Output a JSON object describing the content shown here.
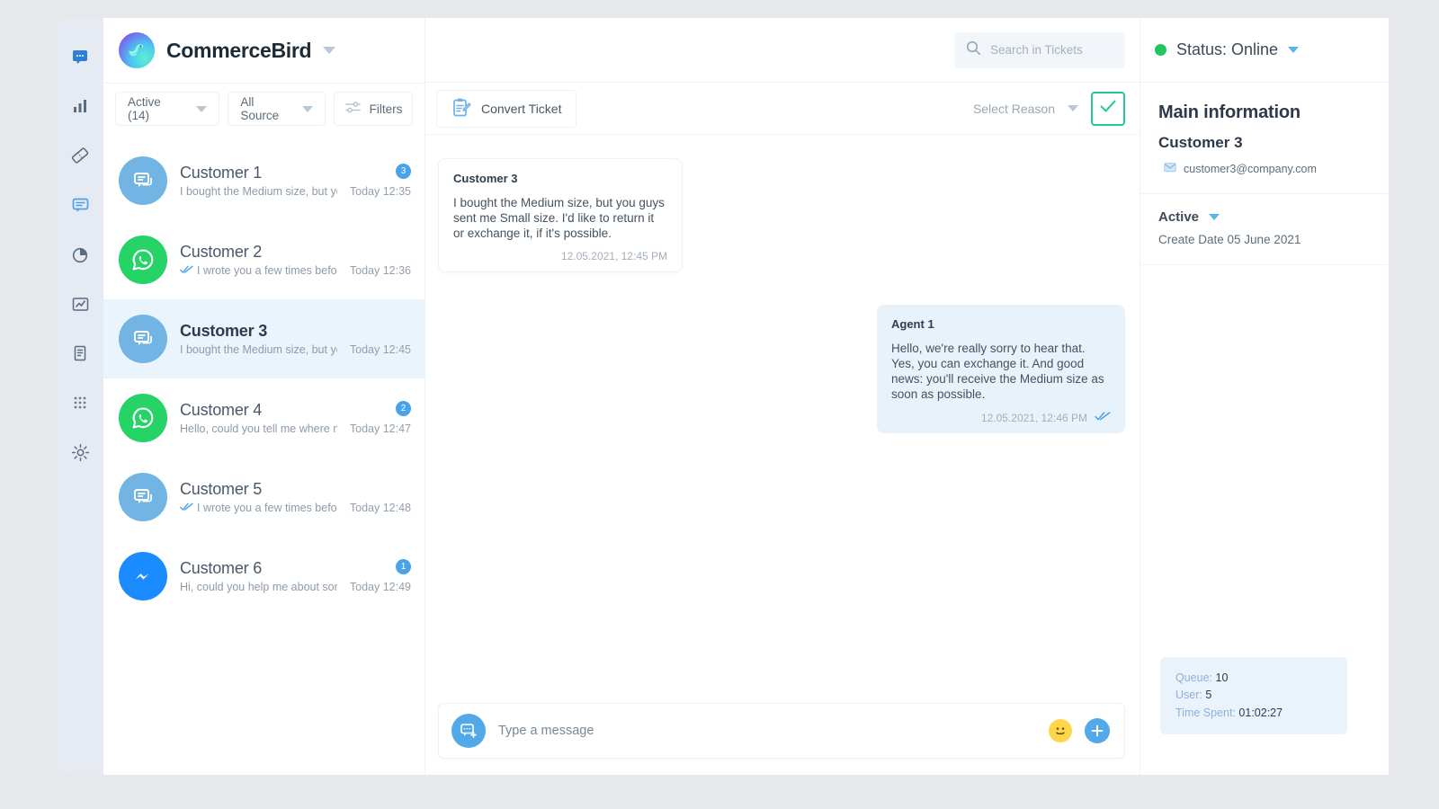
{
  "brand": {
    "name": "CommerceBird",
    "logo_icon": "bird-logo-icon",
    "caret_icon": "chevron-down-icon"
  },
  "rail": {
    "items": [
      {
        "name": "sidebar-item-inbox",
        "icon": "chat-bubble-filled-icon",
        "active": true
      },
      {
        "name": "sidebar-item-statistics",
        "icon": "bar-chart-icon",
        "active": false
      },
      {
        "name": "sidebar-item-tickets",
        "icon": "ticket-icon",
        "active": false
      },
      {
        "name": "sidebar-item-messages",
        "icon": "chat-outline-icon",
        "active": false
      },
      {
        "name": "sidebar-item-reports",
        "icon": "pie-chart-icon",
        "active": false
      },
      {
        "name": "sidebar-item-analytics",
        "icon": "line-chart-icon",
        "active": false
      },
      {
        "name": "sidebar-item-documents",
        "icon": "document-icon",
        "active": false
      },
      {
        "name": "sidebar-item-apps",
        "icon": "grid-dots-icon",
        "active": false
      },
      {
        "name": "sidebar-item-settings",
        "icon": "gear-icon",
        "active": false
      }
    ]
  },
  "filters": {
    "status": "Active (14)",
    "source": "All Source",
    "filters_label": "Filters",
    "filters_icon": "sliders-icon"
  },
  "conversations": [
    {
      "name": "Customer 1",
      "snippet": "I bought the Medium size, but you guys...",
      "time": "Today 12:35",
      "badge": "3",
      "channel": "chat",
      "read_receipt": false,
      "selected": false
    },
    {
      "name": "Customer 2",
      "snippet": "I wrote you a few times before for...",
      "time": "Today 12:36",
      "badge": "",
      "channel": "whatsapp",
      "read_receipt": true,
      "selected": false
    },
    {
      "name": "Customer 3",
      "snippet": "I bought the Medium size, but you...",
      "time": "Today 12:45",
      "badge": "",
      "channel": "chat",
      "read_receipt": false,
      "selected": true
    },
    {
      "name": "Customer 4",
      "snippet": "Hello, could you tell me where my...",
      "time": "Today 12:47",
      "badge": "2",
      "channel": "whatsapp",
      "read_receipt": false,
      "selected": false
    },
    {
      "name": "Customer 5",
      "snippet": "I wrote you a few times before for...",
      "time": "Today 12:48",
      "badge": "",
      "channel": "chat",
      "read_receipt": true,
      "selected": false
    },
    {
      "name": "Customer 6",
      "snippet": "Hi, could you help me about something?",
      "time": "Today 12:49",
      "badge": "1",
      "channel": "messenger",
      "read_receipt": false,
      "selected": false
    }
  ],
  "search": {
    "placeholder": "Search in Tickets",
    "value": "",
    "icon": "search-icon"
  },
  "toolbar": {
    "convert_label": "Convert Ticket",
    "convert_icon": "clipboard-edit-icon",
    "reason_label": "Select Reason",
    "reason_caret_icon": "chevron-down-icon",
    "confirm_icon": "check-icon"
  },
  "messages": [
    {
      "author": "Customer 3",
      "text": "I bought the Medium size, but you guys sent me Small size. I'd like to return it or exchange it, if it's possible.",
      "time": "12.05.2021, 12:45 PM",
      "direction": "in",
      "read_receipt": false
    },
    {
      "author": "Agent 1",
      "text": "Hello, we're really sorry to hear that. Yes, you can exchange it. And good news: you'll receive the Medium size as soon as possible.",
      "time": "12.05.2021, 12:46 PM",
      "direction": "out",
      "read_receipt": true
    }
  ],
  "composer": {
    "placeholder": "Type a message",
    "value": "",
    "add_icon": "add-message-icon",
    "emoji_icon": "smiley-icon",
    "plus_icon": "plus-icon"
  },
  "info": {
    "status_label": "Status: Online",
    "status_dot_color": "#22c55e",
    "status_caret_icon": "chevron-down-icon",
    "heading": "Main information",
    "customer_name": "Customer 3",
    "email": "customer3@company.com",
    "email_icon": "envelope-icon",
    "state_label": "Active",
    "state_caret_icon": "chevron-down-icon",
    "create_date": "Create Date 05 June 2021"
  },
  "stats": {
    "queue_label": "Queue:",
    "queue_value": "10",
    "user_label": "User:",
    "user_value": "5",
    "time_label": "Time Spent:",
    "time_value": "01:02:27"
  },
  "colors": {
    "accent_blue": "#4aa3e8",
    "whatsapp_green": "#25d366",
    "messenger_blue": "#1a8cff",
    "confirm_green": "#20cc88",
    "selected_row": "#eaf4fd"
  }
}
